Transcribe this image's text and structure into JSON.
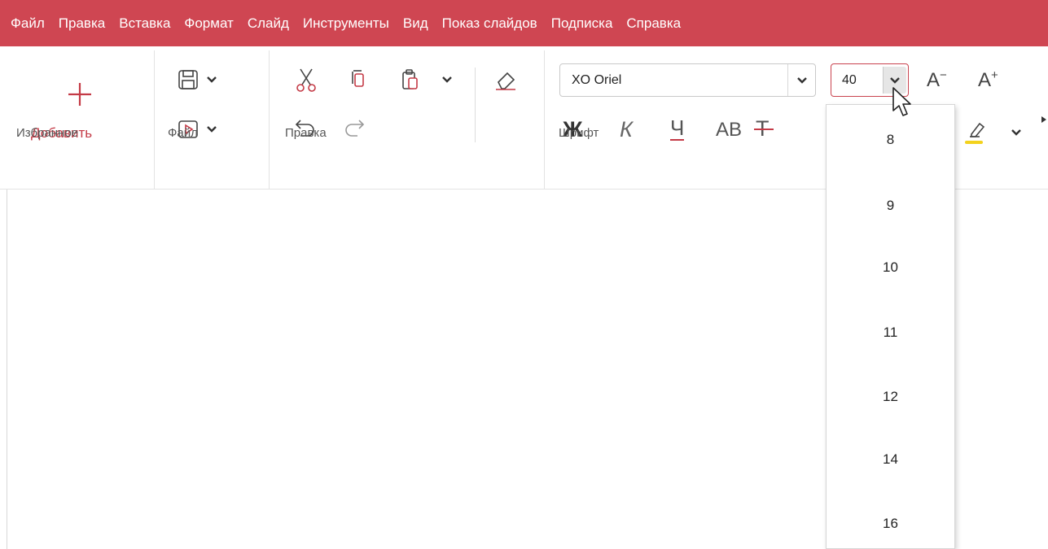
{
  "menu": [
    "Файл",
    "Правка",
    "Вставка",
    "Формат",
    "Слайд",
    "Инструменты",
    "Вид",
    "Показ слайдов",
    "Подписка",
    "Справка"
  ],
  "ribbon": {
    "favorites": {
      "add_label": "Добавить",
      "group_label": "Избранное"
    },
    "file": {
      "group_label": "Файл"
    },
    "edit": {
      "group_label": "Правка"
    },
    "font": {
      "group_label": "Шрифт",
      "font_name": "XO Oriel",
      "font_size": "40",
      "bold": "Ж",
      "italic": "К",
      "underline": "Ч",
      "caps": "AB",
      "strike": "Т",
      "decrease": "A",
      "increase": "A"
    }
  },
  "size_dropdown": {
    "options": [
      "8",
      "9",
      "10",
      "11",
      "12",
      "14",
      "16"
    ]
  },
  "colors": {
    "accent": "#cf4652",
    "highlight": "#f3d21d"
  }
}
